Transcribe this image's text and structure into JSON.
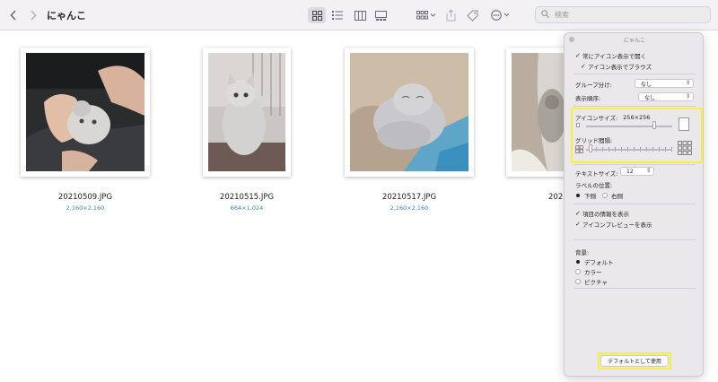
{
  "window": {
    "title": "にゃんこ",
    "search_placeholder": "検索"
  },
  "toolbar": {
    "icons": [
      "chevron-left-icon",
      "chevron-right-icon",
      "icon-view-icon",
      "list-view-icon",
      "column-view-icon",
      "gallery-view-icon",
      "group-icon",
      "share-icon",
      "tag-icon",
      "more-icon",
      "search-icon"
    ]
  },
  "files": [
    {
      "name": "20210509.JPG",
      "dimensions": "2,160×2,160"
    },
    {
      "name": "20210515.JPG",
      "dimensions": "664×1,024"
    },
    {
      "name": "20210517.JPG",
      "dimensions": "2,160×2,160"
    },
    {
      "name": "2021"
    }
  ],
  "panel": {
    "title": "にゃんこ",
    "always_open_icon_view": "常にアイコン表示で開く",
    "browse_icon_view": "アイコン表示でブラウズ",
    "group_by_label": "グループ分け:",
    "group_by_value": "なし",
    "sort_by_label": "表示順序:",
    "sort_by_value": "なし",
    "icon_size_label": "アイコンサイズ:",
    "icon_size_value": "256×256",
    "icon_size_level": 0.79,
    "grid_spacing_label": "グリッド間隔:",
    "grid_spacing_level": 0.05,
    "text_size_label": "テキストサイズ:",
    "text_size_value": "12",
    "label_position_label": "ラベルの位置:",
    "label_bottom": "下側",
    "label_right": "右側",
    "show_item_info": "項目の情報を表示",
    "show_icon_preview": "アイコンプレビューを表示",
    "background_label": "背景:",
    "bg_default": "デフォルト",
    "bg_color": "カラー",
    "bg_picture": "ピクチャ",
    "use_as_defaults": "デフォルトとして使用",
    "highlight_color": "#f7f03b"
  }
}
